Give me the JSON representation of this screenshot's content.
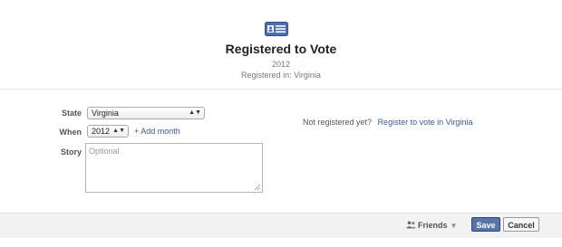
{
  "header": {
    "icon": "voter-card-icon",
    "title": "Registered to Vote",
    "year": "2012",
    "registered_in": "Registered in: Virginia"
  },
  "form": {
    "state_label": "State",
    "state_value": "Virginia",
    "when_label": "When",
    "year_value": "2012",
    "add_month": "+ Add month",
    "story_label": "Story",
    "story_placeholder": "Optional"
  },
  "side": {
    "not_registered": "Not registered yet?",
    "register_link": "Register to vote in Virginia"
  },
  "footer": {
    "audience": "Friends",
    "save": "Save",
    "cancel": "Cancel"
  },
  "colors": {
    "link": "#3b5998",
    "save_button": "#5b74a8",
    "footer_bg": "#f2f2f2"
  }
}
